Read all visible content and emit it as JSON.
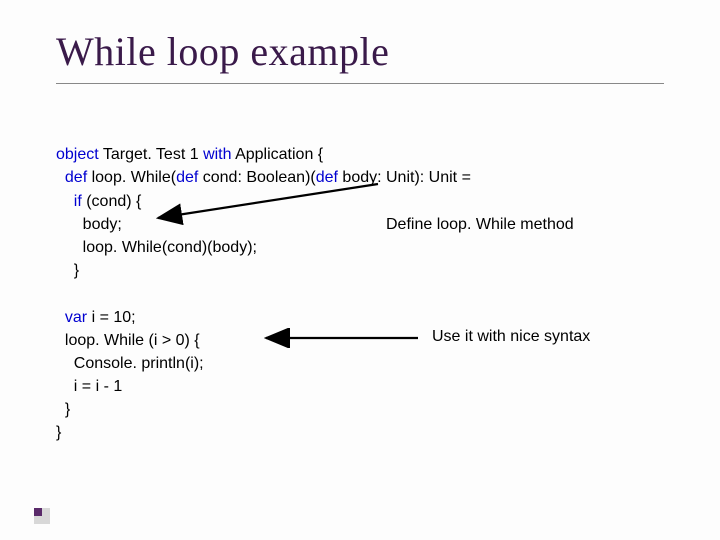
{
  "title": "While loop example",
  "code": {
    "l1": {
      "kw1": "object",
      "t1": " Target. Test 1 ",
      "kw2": "with",
      "t2": " Application {"
    },
    "l2": {
      "pad": "  ",
      "kw1": "def",
      "t1": " loop. While(",
      "kw2": "def",
      "t2": " cond: Boolean)(",
      "kw3": "def",
      "t3": " body: Unit): Unit ="
    },
    "l3": {
      "pad": "    ",
      "kw1": "if",
      "t1": " (cond) {"
    },
    "l4": "      body;",
    "l5": "      loop. While(cond)(body);",
    "l6": "    }",
    "blank": " ",
    "l7": {
      "pad": "  ",
      "kw1": "var",
      "t1": " i = 10;"
    },
    "l8": "  loop. While (i > 0) {",
    "l9": "    Console. println(i);",
    "l10": "    i = i - 1",
    "l11": "  }",
    "l12": "}"
  },
  "annotations": {
    "a1": "Define loop. While method",
    "a2": "Use it with nice syntax"
  }
}
